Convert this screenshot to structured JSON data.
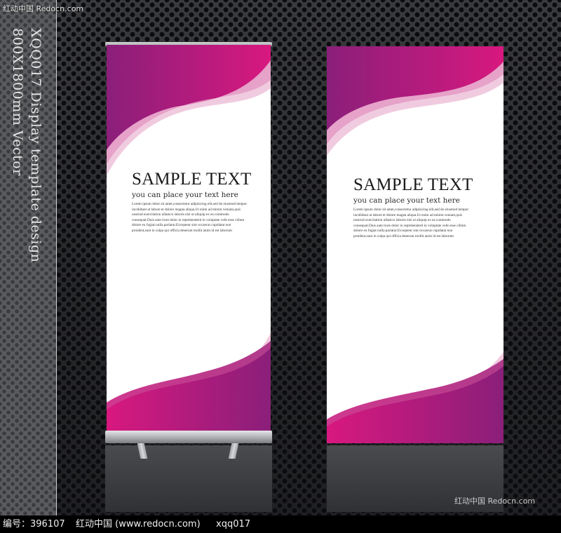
{
  "watermarks": {
    "top_left": "红动中国 Redocn.com",
    "bottom_right": "红动中国 Redocn.com"
  },
  "side_title": {
    "line1": "XQQ017 Display template design",
    "line2": "800X1800mm Vector"
  },
  "banners": [
    {
      "title": "SAMPLE TEXT",
      "subtitle": "you can place your text here",
      "body_lines": [
        "Lorem ipsum dolor sit amet,consectetur adipisicing elit,sed do eiusmod tempor",
        "incididunt ut labore et dolore magna aliqua.Ut enim ad minim veniam,quis",
        "nostrud exercitation ullamco laboris nisi ut aliquip ex ea commodo",
        "consequat.Duis aute irure dolor in reprehenderit in voluptate velit esse cillum",
        "dolore eu fugiat nulla pariatur.Excepteur sint occaecat cupidatat non",
        "proident,sunt in culpa qui officia deserunt mollit anim id est laborum"
      ]
    },
    {
      "title": "SAMPLE TEXT",
      "subtitle": "you can place your text here",
      "body_lines": [
        "Lorem ipsum dolor sit amet,consectetur adipisicing elit,sed do eiusmod tempor",
        "incididunt ut labore et dolore magna aliqua.Ut enim ad minim veniam,quis",
        "nostrud exercitation ullamco laboris nisi ut aliquip ex ea commodo",
        "consequat.Duis aute irure dolor in reprehenderit in voluptate velit esse cillum",
        "dolore eu fugiat nulla pariatur.Excepteur sint occaecat cupidatat non",
        "proident,sunt in culpa qui officia deserunt mollit anim id est laborum"
      ]
    }
  ],
  "footer": {
    "id_label": "编号：396107",
    "site": "红动中国 (www.redocn.com)",
    "code": "xqq017"
  },
  "colors": {
    "magenta": "#d8187f",
    "purple": "#8a1f7a",
    "light_pink": "#f1c9de"
  }
}
